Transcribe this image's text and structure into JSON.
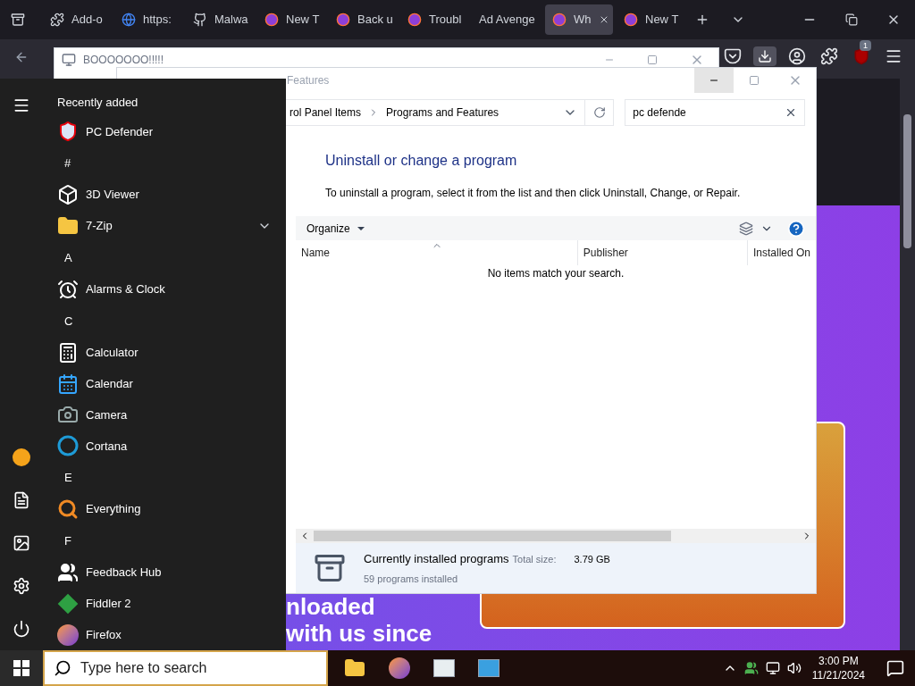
{
  "browser": {
    "tabs": [
      {
        "label": "Add-o",
        "selected": false
      },
      {
        "label": "https:",
        "selected": false
      },
      {
        "label": "Malwa",
        "selected": false
      },
      {
        "label": "New T",
        "selected": false
      },
      {
        "label": "Back u",
        "selected": false
      },
      {
        "label": "Troubl",
        "selected": false
      },
      {
        "label": "Ad Avenge",
        "selected": false
      },
      {
        "label": "Wh",
        "selected": true
      },
      {
        "label": "New T",
        "selected": false
      }
    ],
    "extension_badge": "1",
    "page": {
      "headline_lines": [
        "nloaded",
        "with us since"
      ]
    }
  },
  "back_window": {
    "title": "BOOOOOOO!!!!!"
  },
  "control_panel": {
    "title": "Features",
    "breadcrumb": [
      "rol Panel Items",
      "Programs and Features"
    ],
    "search": {
      "value": "pc defende"
    },
    "heading": "Uninstall or change a program",
    "instructions": "To uninstall a program, select it from the list and then click Uninstall, Change, or Repair.",
    "organize": "Organize",
    "columns": [
      "Name",
      "Publisher",
      "Installed On"
    ],
    "empty_message": "No items match your search.",
    "details": {
      "title": "Currently installed programs",
      "size_label": "Total size:",
      "size_value": "3.79 GB",
      "count": "59 programs installed"
    }
  },
  "start_menu": {
    "items": [
      {
        "kind": "heading",
        "label": "Recently added"
      },
      {
        "kind": "app",
        "label": "PC Defender"
      },
      {
        "kind": "letter",
        "label": "#"
      },
      {
        "kind": "app",
        "label": "3D Viewer"
      },
      {
        "kind": "folder",
        "label": "7-Zip",
        "expanded": false
      },
      {
        "kind": "letter",
        "label": "A"
      },
      {
        "kind": "app",
        "label": "Alarms & Clock"
      },
      {
        "kind": "letter",
        "label": "C"
      },
      {
        "kind": "app",
        "label": "Calculator"
      },
      {
        "kind": "app",
        "label": "Calendar"
      },
      {
        "kind": "app",
        "label": "Camera"
      },
      {
        "kind": "app",
        "label": "Cortana"
      },
      {
        "kind": "letter",
        "label": "E"
      },
      {
        "kind": "app",
        "label": "Everything"
      },
      {
        "kind": "letter",
        "label": "F"
      },
      {
        "kind": "app",
        "label": "Feedback Hub"
      },
      {
        "kind": "app",
        "label": "Fiddler 2"
      },
      {
        "kind": "app",
        "label": "Firefox"
      }
    ]
  },
  "taskbar": {
    "search": {
      "placeholder": "Type here to search"
    },
    "clock": {
      "time": "3:00 PM",
      "date": "11/21/2024"
    }
  }
}
